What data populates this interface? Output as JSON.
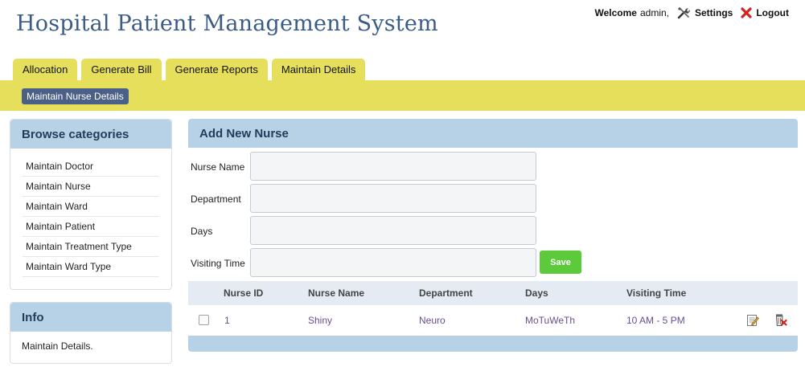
{
  "app": {
    "title": "Hospital Patient Management System"
  },
  "topbar": {
    "welcome": "Welcome",
    "user": "admin,",
    "settings": "Settings",
    "logout": "Logout"
  },
  "tabs": [
    {
      "label": "Allocation"
    },
    {
      "label": "Generate Bill"
    },
    {
      "label": "Generate Reports"
    },
    {
      "label": "Maintain Details"
    }
  ],
  "subtab": {
    "label": "Maintain Nurse Details"
  },
  "browse": {
    "title": "Browse categories",
    "items": [
      {
        "label": "Maintain Doctor"
      },
      {
        "label": "Maintain Nurse"
      },
      {
        "label": "Maintain Ward"
      },
      {
        "label": "Maintain Patient"
      },
      {
        "label": "Maintain Treatment Type"
      },
      {
        "label": "Maintain Ward Type"
      }
    ]
  },
  "info": {
    "title": "Info",
    "text": "Maintain Details."
  },
  "form": {
    "title": "Add New Nurse",
    "fields": [
      {
        "label": "Nurse Name",
        "value": ""
      },
      {
        "label": "Department",
        "value": ""
      },
      {
        "label": "Days",
        "value": ""
      },
      {
        "label": "Visiting Time",
        "value": ""
      }
    ],
    "save_label": "Save"
  },
  "table": {
    "columns": [
      "Nurse ID",
      "Nurse Name",
      "Department",
      "Days",
      "Visiting Time"
    ],
    "rows": [
      {
        "id": "1",
        "name": "Shiny",
        "department": "Neuro",
        "days": "MoTuWeTh",
        "visiting_time": "10 AM - 5 PM"
      }
    ]
  },
  "colors": {
    "accent_yellow": "#e6df5c",
    "header_blue": "#b7d2e6",
    "title_blue": "#3a5b86",
    "save_green": "#5cca3a",
    "link_purple": "#6a4d92"
  },
  "icons": {
    "settings": "tools-icon",
    "logout": "close-x-icon",
    "edit": "edit-icon",
    "delete": "delete-icon"
  }
}
